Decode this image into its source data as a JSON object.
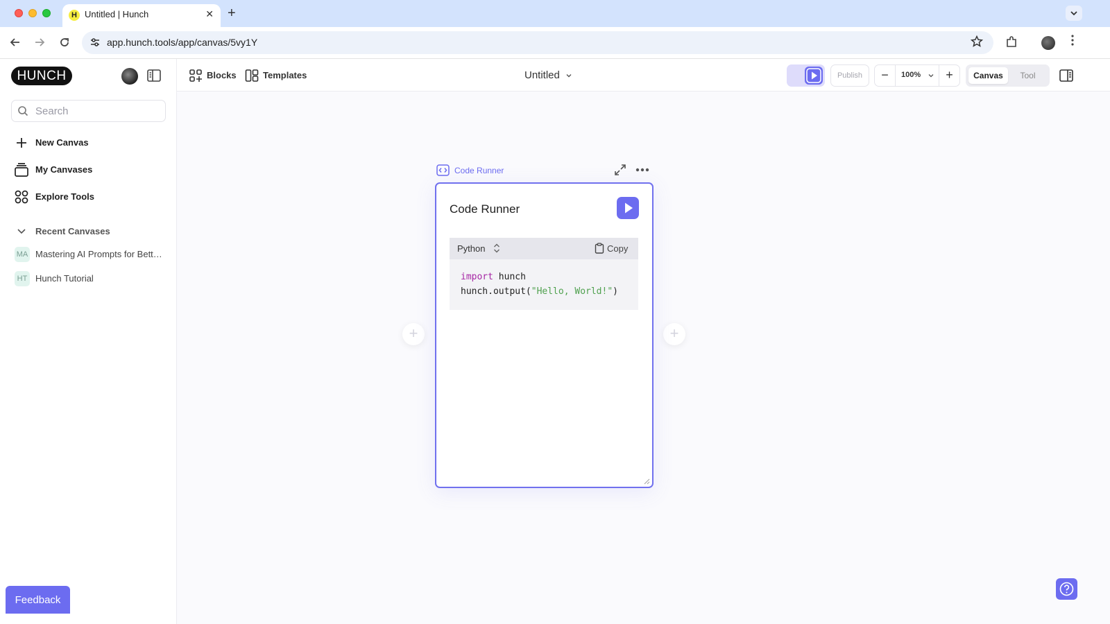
{
  "browser": {
    "tab_title": "Untitled | Hunch",
    "tab_favicon": "H",
    "tab_close": "✕",
    "new_tab": "+",
    "url": "app.hunch.tools/app/canvas/5vy1Y"
  },
  "sidebar": {
    "logo": "HUNCH",
    "search_placeholder": "Search",
    "nav": [
      {
        "label": "New Canvas",
        "icon": "plus-icon"
      },
      {
        "label": "My Canvases",
        "icon": "layers-icon"
      },
      {
        "label": "Explore Tools",
        "icon": "grid-icon"
      }
    ],
    "recent_header": "Recent Canvases",
    "recent": [
      {
        "initials": "MA",
        "label": "Mastering AI Prompts for Bette..."
      },
      {
        "initials": "HT",
        "label": "Hunch Tutorial"
      }
    ],
    "feedback": "Feedback"
  },
  "toolbar": {
    "blocks": "Blocks",
    "templates": "Templates",
    "canvas_title": "Untitled",
    "publish": "Publish",
    "zoom_minus": "−",
    "zoom_plus": "+",
    "zoom": "100%",
    "mode_canvas": "Canvas",
    "mode_tool": "Tool"
  },
  "node": {
    "type_label": "Code Runner",
    "title": "Code Runner",
    "language": "Python",
    "copy": "Copy",
    "code": {
      "line1_keyword": "import",
      "line1_rest": " hunch",
      "line2_prefix": "hunch.output(",
      "line2_string": "\"Hello, World!\"",
      "line2_suffix": ")"
    }
  },
  "canvas": {
    "add": "+"
  },
  "colors": {
    "accent": "#6c6cf0",
    "tab_bar": "#d3e3fd",
    "code_keyword": "#a626a4",
    "code_string": "#50a14f"
  }
}
